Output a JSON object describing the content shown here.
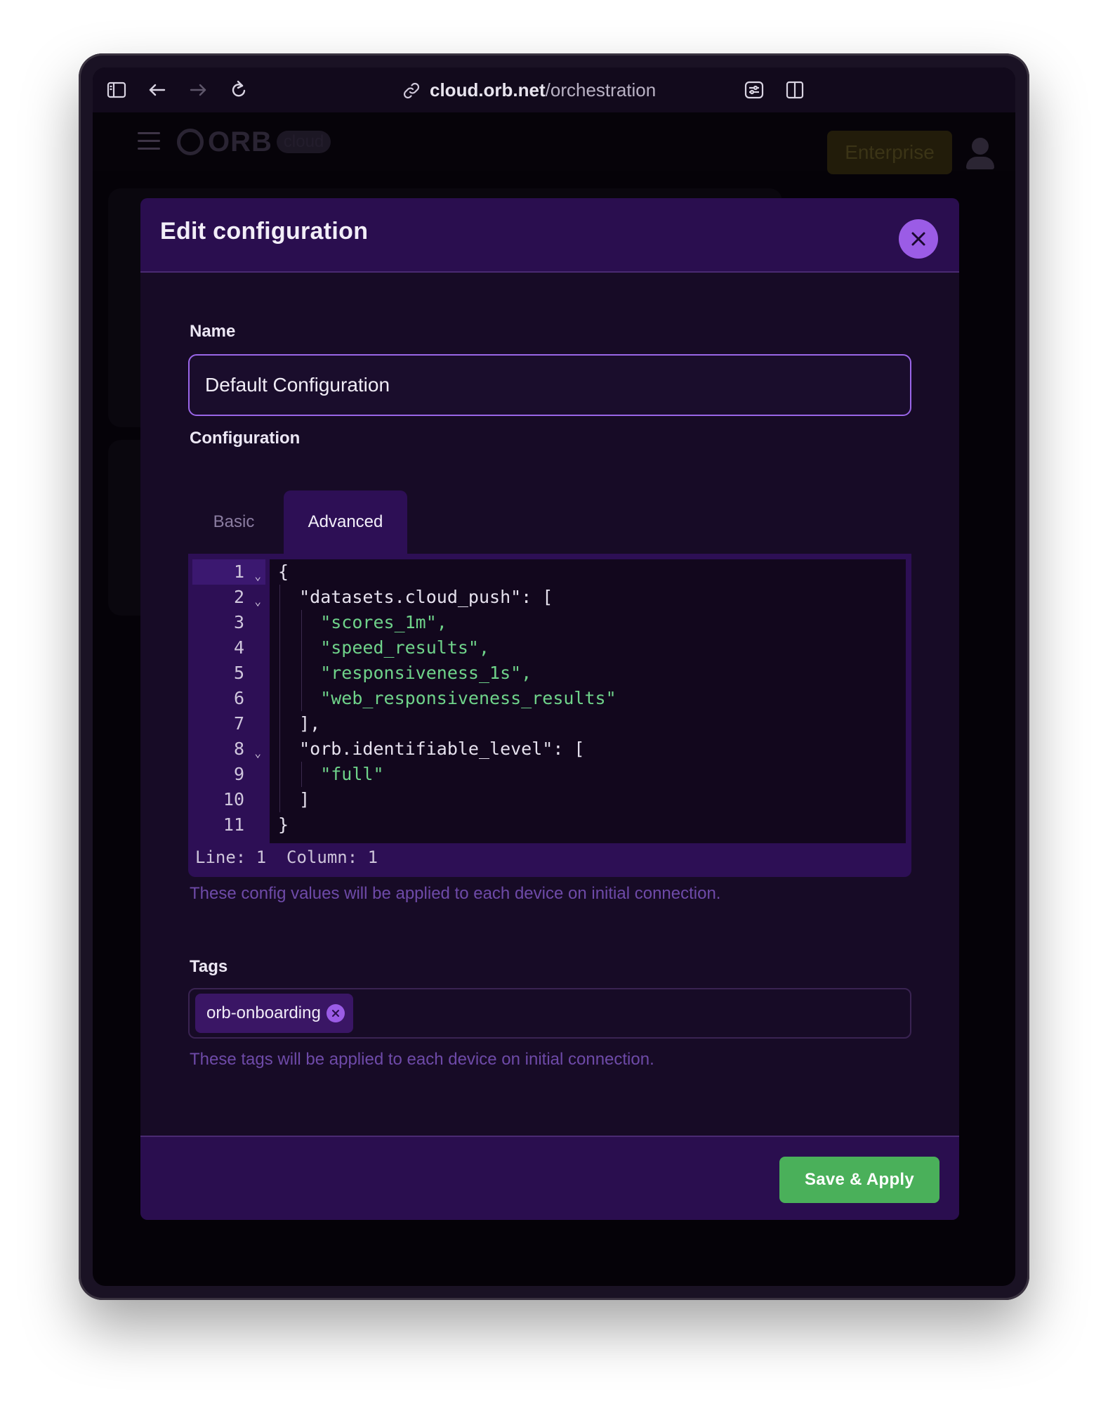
{
  "browser": {
    "url_host": "cloud.orb.net",
    "url_path": "/orchestration",
    "icons": [
      "sidebar-icon",
      "back-icon",
      "forward-icon",
      "reload-icon",
      "link-icon",
      "extensions-icon",
      "split-view-icon"
    ]
  },
  "app": {
    "logo_text": "ORB",
    "logo_sub": "cloud",
    "enterprise_label": "Enterprise"
  },
  "modal": {
    "title": "Edit configuration",
    "name_label": "Name",
    "name_value": "Default Configuration",
    "config_label": "Configuration",
    "tabs": [
      {
        "label": "Basic",
        "active": false
      },
      {
        "label": "Advanced",
        "active": true
      }
    ],
    "editor": {
      "line_numbers": [
        "1",
        "2",
        "3",
        "4",
        "5",
        "6",
        "7",
        "8",
        "9",
        "10",
        "11"
      ],
      "lines": [
        "{",
        "  \"datasets.cloud_push\": [",
        "    \"scores_1m\",",
        "    \"speed_results\",",
        "    \"responsiveness_1s\",",
        "    \"web_responsiveness_results\"",
        "  ],",
        "  \"orb.identifiable_level\": [",
        "    \"full\"",
        "  ]",
        "}"
      ],
      "status": "Line: 1  Column: 1"
    },
    "config_hint": "These config values will be applied to each device on initial connection.",
    "tags_label": "Tags",
    "tags": [
      "orb-onboarding"
    ],
    "tags_hint": "These tags will be applied to each device on initial connection.",
    "save_label": "Save & Apply"
  },
  "colors": {
    "accent": "#9b5ce6",
    "modal_header": "#2a0e4f",
    "save": "#4ab05a",
    "string": "#6fd38a"
  }
}
